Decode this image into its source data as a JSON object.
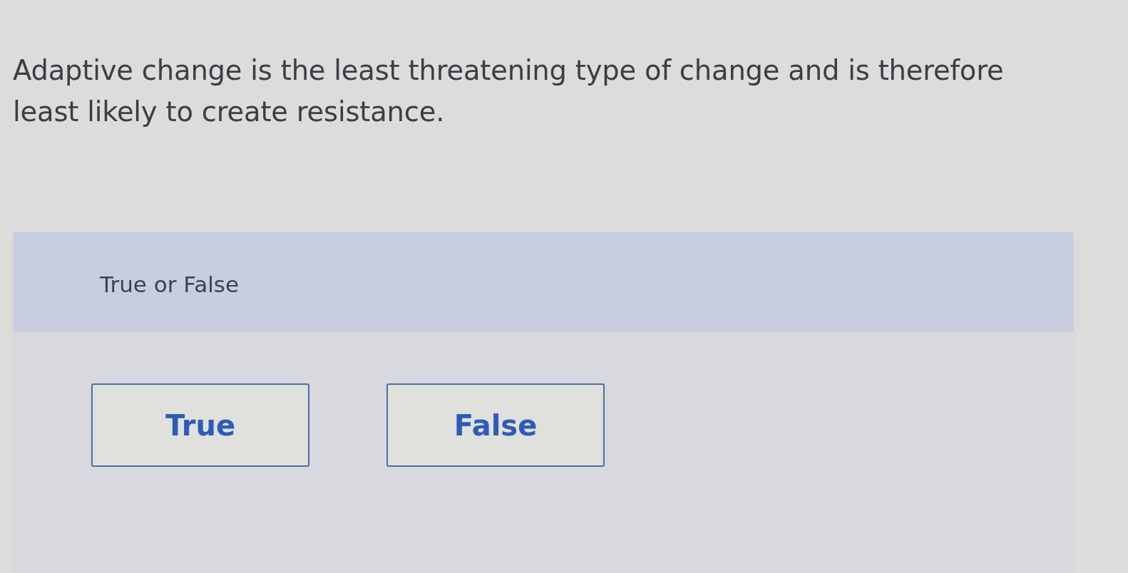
{
  "question": {
    "text": "Adaptive change is the least threatening type of change and is therefore least likely to create resistance."
  },
  "answer_panel": {
    "prompt": "True or False",
    "options": [
      {
        "label": "True",
        "selected": false
      },
      {
        "label": "False",
        "selected": false
      }
    ]
  }
}
